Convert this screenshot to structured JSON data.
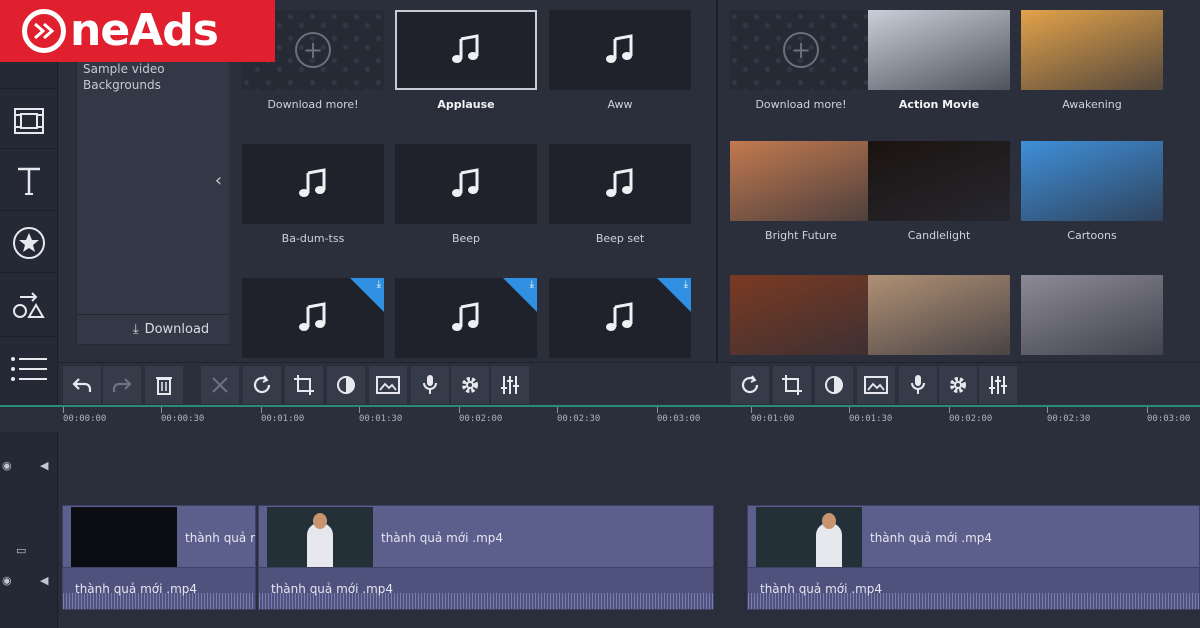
{
  "logo": {
    "text": "neAds",
    "mark": "O"
  },
  "category_panel": {
    "lines": [
      "Sample video",
      "Backgrounds"
    ],
    "download_label": "Download"
  },
  "collapse_glyph": "‹",
  "left_grid": [
    {
      "label": "Download more!",
      "kind": "download",
      "bold": false
    },
    {
      "label": "Applause",
      "kind": "music",
      "bold": true,
      "selected": true
    },
    {
      "label": "Aww",
      "kind": "music",
      "bold": false
    },
    {
      "label": "Ba-dum-tss",
      "kind": "music",
      "bold": false
    },
    {
      "label": "Beep",
      "kind": "music",
      "bold": false
    },
    {
      "label": "Beep set",
      "kind": "music",
      "bold": false
    },
    {
      "label": "",
      "kind": "music-download",
      "bold": false
    },
    {
      "label": "",
      "kind": "music-download",
      "bold": false
    },
    {
      "label": "",
      "kind": "music-download",
      "bold": false
    }
  ],
  "right_grid": [
    {
      "label": "Download more!",
      "kind": "download",
      "bold": false,
      "color": ""
    },
    {
      "label": "Action Movie",
      "kind": "video",
      "bold": true,
      "color": "#c9cfd8"
    },
    {
      "label": "Awakening",
      "kind": "video",
      "bold": false,
      "color": "#e2a24a"
    },
    {
      "label": "Bright Future",
      "kind": "video",
      "bold": false,
      "color": "#c27a4f"
    },
    {
      "label": "Candlelight",
      "kind": "video",
      "bold": false,
      "color": "#1b1310"
    },
    {
      "label": "Cartoons",
      "kind": "video",
      "bold": false,
      "color": "#3f8fd8"
    },
    {
      "label": "",
      "kind": "video",
      "bold": false,
      "color": "#7b3a22"
    },
    {
      "label": "",
      "kind": "video",
      "bold": false,
      "color": "#b09074"
    },
    {
      "label": "",
      "kind": "video",
      "bold": false,
      "color": "#8c8a96"
    }
  ],
  "ruler": {
    "left": [
      "00:00:00",
      "00:00:30",
      "00:01:00",
      "00:01:30",
      "00:02:00",
      "00:02:30",
      "00:03:00"
    ],
    "right": [
      "00:01:00",
      "00:01:30",
      "00:02:00",
      "00:02:30",
      "00:03:00"
    ]
  },
  "clips": {
    "clip1_name": "thành quả r",
    "clip2_name": "thành quả mới .mp4",
    "clip3_name": "thành quả mới .mp4",
    "audio1_name": "thành quả mới .mp4",
    "audio2_name": "thành quả mới .mp4",
    "audio3_name": "thành quả mới .mp4"
  },
  "colors": {
    "brand": "#e0202e",
    "accent_line": "#2c8a7a",
    "download_corner": "#2f8fe0",
    "clip": "#5c5f8c"
  }
}
